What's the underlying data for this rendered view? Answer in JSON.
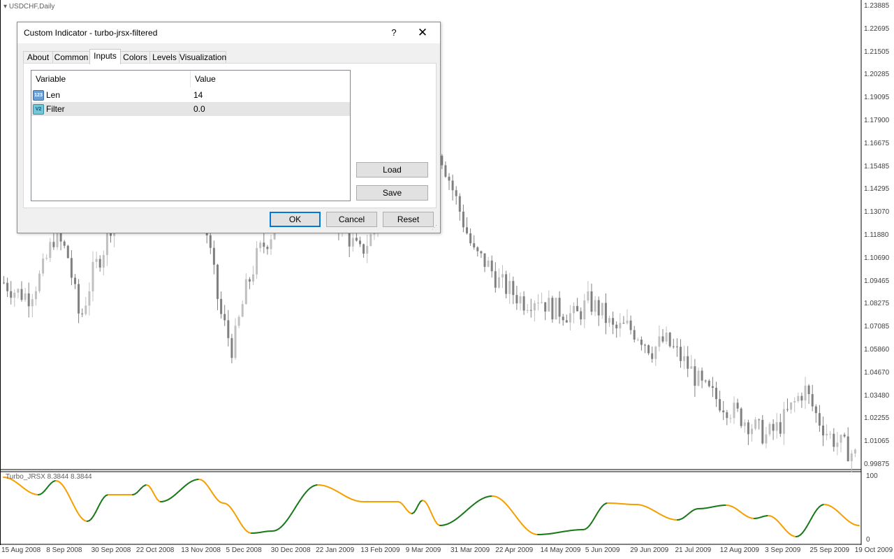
{
  "chart": {
    "symbol_title": "USDCHF,Daily",
    "indicator_label": "Turbo_JRSX 8.3844 8.3844",
    "price_axis": [
      "1.23885",
      "1.22695",
      "1.21505",
      "1.20285",
      "1.19095",
      "1.17900",
      "1.16675",
      "1.15485",
      "1.14295",
      "1.13070",
      "1.11880",
      "1.10690",
      "1.09465",
      "1.08275",
      "1.07085",
      "1.05860",
      "1.04670",
      "1.03480",
      "1.02255",
      "1.01065",
      "0.99875"
    ],
    "osc_axis": [
      "100",
      "0"
    ],
    "date_axis": [
      "15 Aug 2008",
      "8 Sep 2008",
      "30 Sep 2008",
      "22 Oct 2008",
      "13 Nov 2008",
      "5 Dec 2008",
      "30 Dec 2008",
      "22 Jan 2009",
      "13 Feb 2009",
      "9 Mar 2009",
      "31 Mar 2009",
      "22 Apr 2009",
      "14 May 2009",
      "5 Jun 2009",
      "29 Jun 2009",
      "21 Jul 2009",
      "12 Aug 2009",
      "3 Sep 2009",
      "25 Sep 2009",
      "19 Oct 2009"
    ],
    "colors": {
      "up_line": "#1a7a1a",
      "down_line": "#f5a000",
      "candle_bear": "#808080",
      "candle_bull": "#c0c0c0"
    },
    "close_path": [
      1.095,
      1.09,
      1.088,
      1.1,
      1.12,
      1.11,
      1.075,
      1.1,
      1.115,
      1.14,
      1.16,
      1.18,
      1.2,
      1.21,
      1.19,
      1.15,
      1.12,
      1.08,
      1.06,
      1.09,
      1.11,
      1.12,
      1.14,
      1.155,
      1.17,
      1.165,
      1.13,
      1.12,
      1.11,
      1.12,
      1.135,
      1.14,
      1.15,
      1.165,
      1.17,
      1.15,
      1.13,
      1.11,
      1.105,
      1.095,
      1.09,
      1.085,
      1.088,
      1.082,
      1.08,
      1.077,
      1.085,
      1.08,
      1.07,
      1.072,
      1.068,
      1.06,
      1.065,
      1.058,
      1.05,
      1.04,
      1.035,
      1.03,
      1.025,
      1.02,
      1.015,
      1.02,
      1.03,
      1.04,
      1.025,
      1.015,
      1.01,
      1.005
    ]
  },
  "dialog": {
    "title": "Custom Indicator - turbo-jrsx-filtered",
    "help_label": "?",
    "close_label": "✕",
    "tabs": [
      "About",
      "Common",
      "Inputs",
      "Colors",
      "Levels",
      "Visualization"
    ],
    "active_tab": "Inputs",
    "grid": {
      "col_variable": "Variable",
      "col_value": "Value",
      "rows": [
        {
          "icon": "integer-param-icon",
          "icon_text": "123",
          "name": "Len",
          "value": "14"
        },
        {
          "icon": "double-param-icon",
          "icon_text": "V2",
          "name": "Filter",
          "value": "0.0"
        }
      ]
    },
    "buttons": {
      "load": "Load",
      "save": "Save",
      "ok": "OK",
      "cancel": "Cancel",
      "reset": "Reset"
    }
  }
}
